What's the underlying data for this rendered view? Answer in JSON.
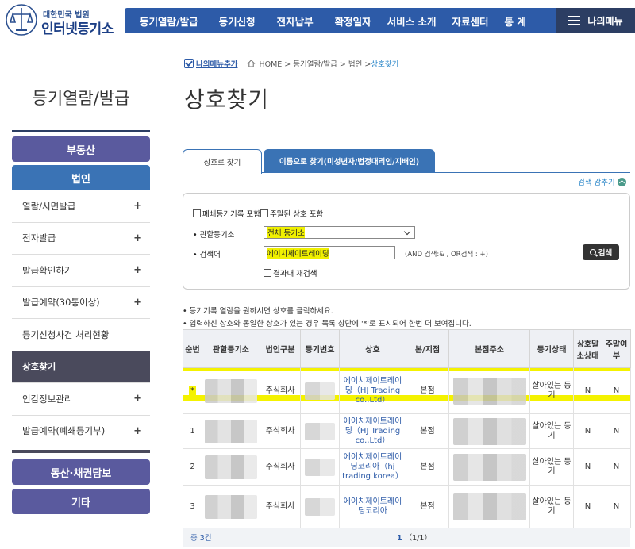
{
  "header": {
    "logo_top": "대한민국 법원",
    "logo_main": "인터넷등기소",
    "nav": [
      "등기열람/발급",
      "등기신청",
      "전자납부",
      "확정일자",
      "서비스 소개",
      "자료센터",
      "통 계"
    ],
    "my_menu": "나의메뉴"
  },
  "sidebar": {
    "title": "등기열람/발급",
    "top_buttons": [
      "부동산",
      "법인"
    ],
    "items": [
      {
        "label": "열람/서면발급",
        "plus": "+"
      },
      {
        "label": "전자발급",
        "plus": "+"
      },
      {
        "label": "발급확인하기",
        "plus": "+"
      },
      {
        "label": "발급예약(30통이상)",
        "plus": "+"
      },
      {
        "label": "등기신청사건 처리현황",
        "plus": ""
      },
      {
        "label": "상호찾기",
        "plus": ""
      },
      {
        "label": "인감정보관리",
        "plus": "+"
      },
      {
        "label": "발급예약(폐쇄등기부)",
        "plus": "+"
      }
    ],
    "bottom_buttons": [
      "동산·채권담보",
      "기타"
    ]
  },
  "breadcrumb": {
    "fav": "나의메뉴추가",
    "path": "HOME > 등기열람/발급 > 법인 > ",
    "current": "상호찾기"
  },
  "page_title": "상호찾기",
  "tabs": {
    "active": "상호로 찾기",
    "inactive": "이름으로 찾기(미성년자/법정대리인/지배인)"
  },
  "collapse_label": "검색 감추기",
  "search": {
    "chk_closed": "폐쇄등기기록 포함",
    "chk_dormant": "주말된 상호 포함",
    "registry_label": "• 관할등기소",
    "registry_value": "전체 등기소",
    "keyword_label": "• 검색어",
    "keyword_value": "에이치제이트레이딩",
    "hint": "(AND 검색:& , OR검색 : +)",
    "button": "검색",
    "refine": "결과내 재검색"
  },
  "notes": [
    "• 등기기록 열람을 원하시면 상호를 클릭하세요.",
    "• 입력하신 상호와 동일한 상호가 있는 경우 목록 상단에 '*'로 표시되어 한번 더 보여집니다."
  ],
  "table": {
    "headers": [
      "순번",
      "관할등기소",
      "법인구분",
      "등기번호",
      "상호",
      "본/지점",
      "본점주소",
      "등기상태",
      "상호말소상태",
      "주말여부"
    ],
    "rows": [
      {
        "no": "*",
        "type": "주식회사",
        "name": "에이치제이트레이딩（HJ Trading co.,Ltd）",
        "branch": "본점",
        "status": "살아있는 등기",
        "erased": "N",
        "dormant": "N"
      },
      {
        "no": "1",
        "type": "주식회사",
        "name": "에이치제이트레이딩（HJ Trading co.,Ltd）",
        "branch": "본점",
        "status": "살아있는 등기",
        "erased": "N",
        "dormant": "N"
      },
      {
        "no": "2",
        "type": "주식회사",
        "name": "에이치제이트레이딩코리아（hj trading korea）",
        "branch": "본점",
        "status": "살아있는 등기",
        "erased": "N",
        "dormant": "N"
      },
      {
        "no": "3",
        "type": "주식회사",
        "name": "에이치제이트레이딩코리아",
        "branch": "본점",
        "status": "살아있는 등기",
        "erased": "N",
        "dormant": "N"
      }
    ]
  },
  "footer": {
    "total": "총 3건",
    "page_current": "1",
    "page_info": "（1/1）"
  },
  "colors": {
    "nav_blue": "#2d5ba8",
    "mymenu_dark": "#2c3e63",
    "side_purple": "#5a5a9e",
    "side_blue": "#3a73b5",
    "active_item": "#4a4a5c",
    "highlight_yellow": "#f4f200"
  }
}
